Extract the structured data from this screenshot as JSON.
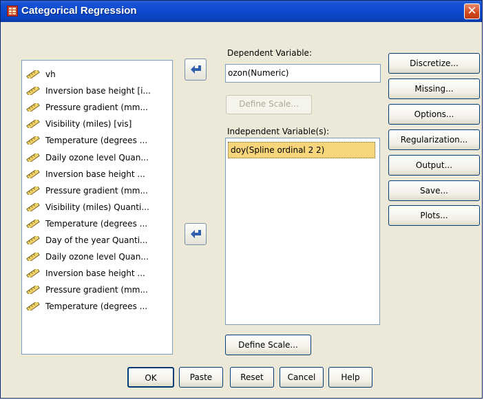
{
  "window": {
    "title": "Categorical Regression",
    "close_glyph": "✕"
  },
  "variables": [
    "vh",
    "Inversion base height [i...",
    "Pressure gradient (mm...",
    "Visibility (miles) [vis]",
    "Temperature (degrees ...",
    "Daily ozone level Quan...",
    "Inversion base height ...",
    "Pressure gradient (mm...",
    "Visibility (miles) Quanti...",
    "Temperature (degrees ...",
    "Day of the year Quanti...",
    "Daily ozone level Quan...",
    "Inversion base height ...",
    "Pressure gradient (mm...",
    "Temperature (degrees ..."
  ],
  "dependent": {
    "label": "Dependent Variable:",
    "value": "ozon(Numeric)",
    "define_scale": "Define Scale..."
  },
  "independent": {
    "label": "Independent Variable(s):",
    "items": [
      "doy(Spline ordinal 2 2)"
    ],
    "define_scale": "Define Scale..."
  },
  "side_buttons": {
    "discretize": "Discretize...",
    "missing": "Missing...",
    "options": "Options...",
    "regularization": "Regularization...",
    "output": "Output...",
    "save": "Save...",
    "plots": "Plots..."
  },
  "bottom_buttons": {
    "ok": "OK",
    "paste": "Paste",
    "reset": "Reset",
    "cancel": "Cancel",
    "help": "Help"
  },
  "colors": {
    "titlebar": "#0b49cc",
    "dialog_bg": "#ece9d8",
    "selection": "#f7d57a",
    "arrow": "#2f5fae"
  },
  "icons": {
    "title": "table-icon",
    "variable": "ruler-icon",
    "transfer": "transfer-arrow-icon"
  }
}
